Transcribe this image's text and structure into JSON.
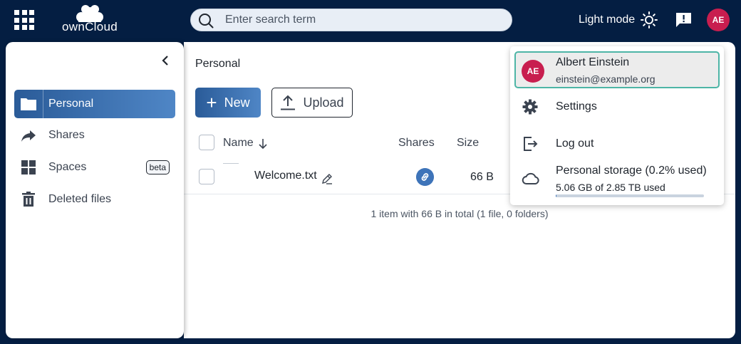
{
  "topbar": {
    "logo_text": "ownCloud",
    "search_placeholder": "Enter search term",
    "theme_toggle_label": "Light mode",
    "user_initials": "AE"
  },
  "sidebar": {
    "items": [
      {
        "label": "Personal",
        "icon": "folder-icon",
        "active": true
      },
      {
        "label": "Shares",
        "icon": "share-arrow-icon"
      },
      {
        "label": "Spaces",
        "icon": "grid-icon",
        "badge": "beta"
      },
      {
        "label": "Deleted files",
        "icon": "trash-icon"
      }
    ]
  },
  "main": {
    "breadcrumb": "Personal",
    "new_label": "New",
    "upload_label": "Upload",
    "columns": {
      "name": "Name",
      "shares": "Shares",
      "size": "Size"
    },
    "files": [
      {
        "name": "Welcome.txt",
        "size": "66 B"
      }
    ],
    "summary": "1 item with 66 B in total (1 file, 0 folders)"
  },
  "user_menu": {
    "initials": "AE",
    "name": "Albert Einstein",
    "email": "einstein@example.org",
    "settings_label": "Settings",
    "logout_label": "Log out",
    "storage_title": "Personal storage (0.2% used)",
    "storage_detail": "5.06 GB of 2.85 TB used",
    "storage_used_percent": 0.2
  },
  "colors": {
    "topbar_bg": "#041e42",
    "accent": "#3e74b9",
    "avatar": "#c81e4f",
    "focus_border": "#4db5a6"
  }
}
